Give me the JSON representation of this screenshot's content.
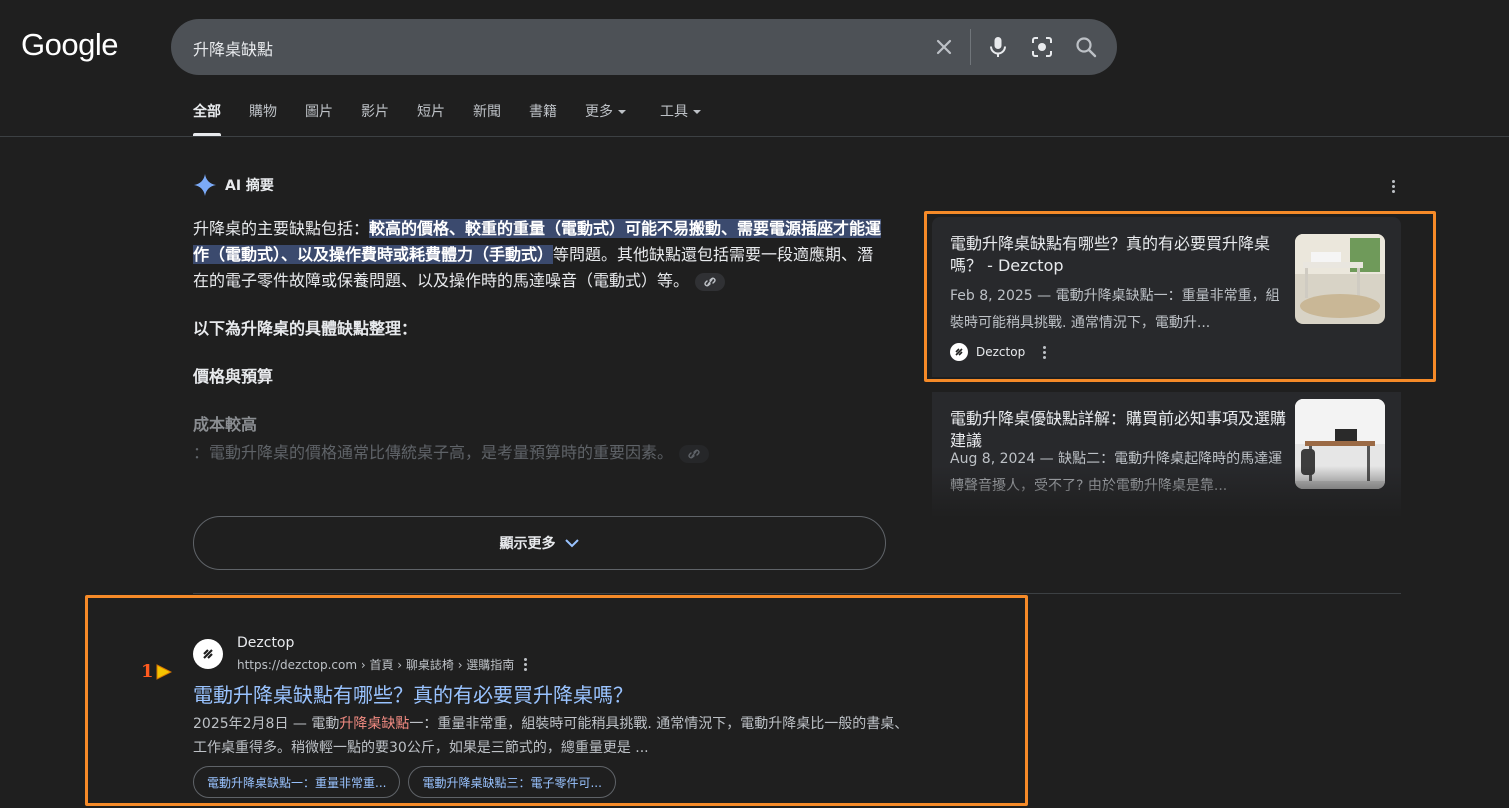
{
  "header": {
    "logo": "Google",
    "search_query": "升降桌缺點",
    "tabs": [
      {
        "label": "全部"
      },
      {
        "label": "購物"
      },
      {
        "label": "圖片"
      },
      {
        "label": "影片"
      },
      {
        "label": "短片"
      },
      {
        "label": "新聞"
      },
      {
        "label": "書籍"
      },
      {
        "label": "更多"
      },
      {
        "label": "工具"
      }
    ]
  },
  "ai_overview": {
    "title": "AI 摘要",
    "intro_lead": "升降桌的主要缺點包括：",
    "intro_highlight": "較高的價格、較重的重量（電動式）可能不易搬動、需要電源插座才能運作（電動式）、以及操作費時或耗費體力（手動式）",
    "intro_tail": "等問題。其他缺點還包括需要一段適應期、潛在的電子零件故障或保養問題、以及操作時的馬達噪音（電動式）等。",
    "subheading": "以下為升降桌的具體缺點整理：",
    "section_heading": "價格與預算",
    "item_title": "成本較高",
    "item_text": "：電動升降桌的價格通常比傳統桌子高，是考量預算時的重要因素。",
    "show_more": "顯示更多"
  },
  "sources": [
    {
      "title": "電動升降桌缺點有哪些？真的有必要買升降桌嗎？ - Dezctop",
      "snippet": "Feb 8, 2025 — 電動升降桌缺點一：重量非常重，組裝時可能稍具挑戰. 通常情況下，電動升...",
      "site": "Dezctop"
    },
    {
      "title": "電動升降桌優缺點詳解：購買前必知事項及選購建議",
      "snippet": "Aug 8, 2024 — 缺點二：電動升降桌起降時的馬達運轉聲音擾人，受不了? 由於電動升降桌是靠..."
    }
  ],
  "result": {
    "site_name": "Dezctop",
    "breadcrumb": "https://dezctop.com › 首頁 › 聊桌誌椅 › 選購指南",
    "title": "電動升降桌缺點有哪些？真的有必要買升降桌嗎？",
    "snippet_date": "2025年2月8日 — 電動",
    "snippet_em": "升降桌缺點",
    "snippet_rest": "一：重量非常重，組裝時可能稍具挑戰. 通常情況下，電動升降桌比一般的書桌、工作桌重得多。稍微輕一點的要30公斤，如果是三節式的，總重量更是 ...",
    "chips": [
      "電動升降桌缺點一：重量非常重...",
      "電動升降桌缺點三：電子零件可..."
    ]
  },
  "annotation": {
    "marker_label": "1"
  },
  "colors": {
    "background": "#1f1f1f",
    "link": "#99c3ff",
    "highlight_box": "#f58a28",
    "emphasis": "#f28b82"
  }
}
